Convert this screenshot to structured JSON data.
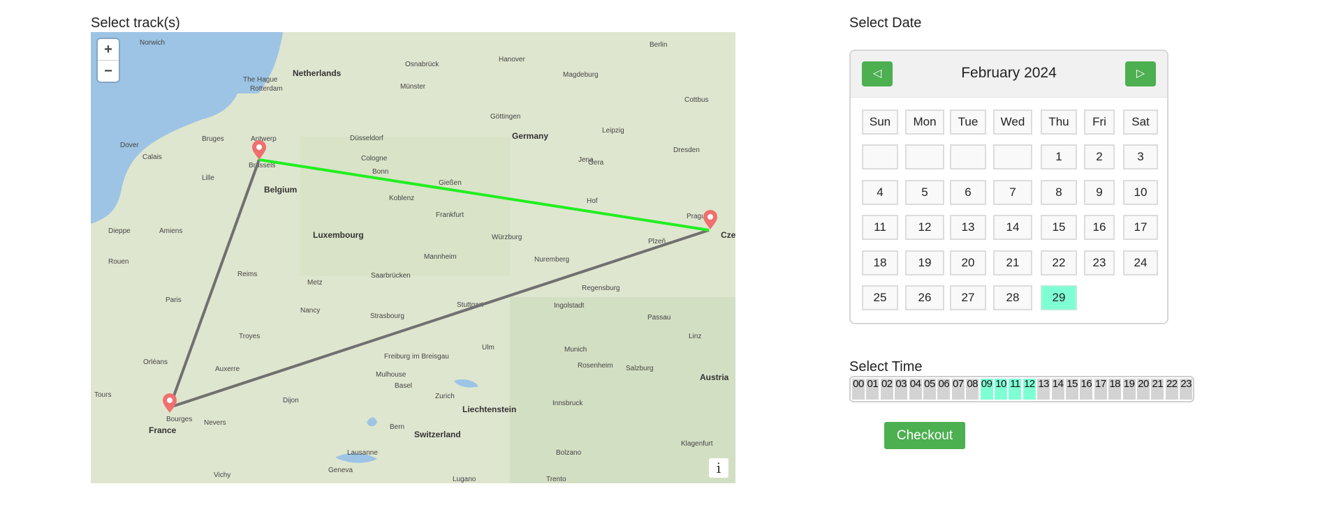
{
  "labels": {
    "tracks": "Select track(s)",
    "date": "Select Date",
    "time": "Select Time"
  },
  "map": {
    "zoom_in": "+",
    "zoom_out": "−",
    "attribution": "i",
    "places": [
      {
        "name": "Norwich"
      },
      {
        "name": "Berlin"
      },
      {
        "name": "Netherlands"
      },
      {
        "name": "The Hague"
      },
      {
        "name": "Rotterdam"
      },
      {
        "name": "Osnabrück"
      },
      {
        "name": "Hanover"
      },
      {
        "name": "Magdeburg"
      },
      {
        "name": "Münster"
      },
      {
        "name": "Dover"
      },
      {
        "name": "Bruges"
      },
      {
        "name": "Antwerp"
      },
      {
        "name": "Calais"
      },
      {
        "name": "Lille"
      },
      {
        "name": "Brussels"
      },
      {
        "name": "Belgium"
      },
      {
        "name": "Düsseldorf"
      },
      {
        "name": "Cologne"
      },
      {
        "name": "Bonn"
      },
      {
        "name": "Göttingen"
      },
      {
        "name": "Germany"
      },
      {
        "name": "Leipzig"
      },
      {
        "name": "Dresden"
      },
      {
        "name": "Cottbus"
      },
      {
        "name": "Jena"
      },
      {
        "name": "Gera"
      },
      {
        "name": "Gießen"
      },
      {
        "name": "Koblenz"
      },
      {
        "name": "Frankfurt"
      },
      {
        "name": "Hof"
      },
      {
        "name": "Prague"
      },
      {
        "name": "Dieppe"
      },
      {
        "name": "Amiens"
      },
      {
        "name": "Luxembourg"
      },
      {
        "name": "Würzburg"
      },
      {
        "name": "Mannheim"
      },
      {
        "name": "Plzeň"
      },
      {
        "name": "Nuremberg"
      },
      {
        "name": "Rouen"
      },
      {
        "name": "Reims"
      },
      {
        "name": "Saarbrücken"
      },
      {
        "name": "Metz"
      },
      {
        "name": "Regensburg"
      },
      {
        "name": "Paris"
      },
      {
        "name": "Nancy"
      },
      {
        "name": "Stuttgart"
      },
      {
        "name": "Ingolstadt"
      },
      {
        "name": "Passau"
      },
      {
        "name": "Strasbourg"
      },
      {
        "name": "Troyes"
      },
      {
        "name": "Ulm"
      },
      {
        "name": "Linz"
      },
      {
        "name": "Munich"
      },
      {
        "name": "Orléans"
      },
      {
        "name": "Auxerre"
      },
      {
        "name": "Freiburg im Breisgau"
      },
      {
        "name": "Rosenheim"
      },
      {
        "name": "Salzburg"
      },
      {
        "name": "Austria"
      },
      {
        "name": "Mulhouse"
      },
      {
        "name": "Basel"
      },
      {
        "name": "Tours"
      },
      {
        "name": "Dijon"
      },
      {
        "name": "Zurich"
      },
      {
        "name": "Liechtenstein"
      },
      {
        "name": "Innsbruck"
      },
      {
        "name": "Bourges"
      },
      {
        "name": "Nevers"
      },
      {
        "name": "Bern"
      },
      {
        "name": "Switzerland"
      },
      {
        "name": "France"
      },
      {
        "name": "Klagenfurt"
      },
      {
        "name": "Lausanne"
      },
      {
        "name": "Bolzano"
      },
      {
        "name": "Geneva"
      },
      {
        "name": "Vichy"
      },
      {
        "name": "Lugano"
      },
      {
        "name": "Trento"
      },
      {
        "name": "Czech"
      }
    ]
  },
  "calendar": {
    "month": "February 2024",
    "prev": "◁",
    "next": "▷",
    "weekdays": [
      "Sun",
      "Mon",
      "Tue",
      "Wed",
      "Thu",
      "Fri",
      "Sat"
    ],
    "first_weekday": 4,
    "days": 29,
    "selected_day": 29
  },
  "time": {
    "hours": [
      "00",
      "01",
      "02",
      "03",
      "04",
      "05",
      "06",
      "07",
      "08",
      "09",
      "10",
      "11",
      "12",
      "13",
      "14",
      "15",
      "16",
      "17",
      "18",
      "19",
      "20",
      "21",
      "22",
      "23"
    ],
    "selected": [
      "09",
      "10",
      "11",
      "12"
    ]
  },
  "checkout": "Checkout",
  "colors": {
    "accent": "#4caf50",
    "selected": "#7fffd4",
    "track_active": "#22ee22",
    "track": "#707070",
    "marker": "#f06f6f"
  }
}
